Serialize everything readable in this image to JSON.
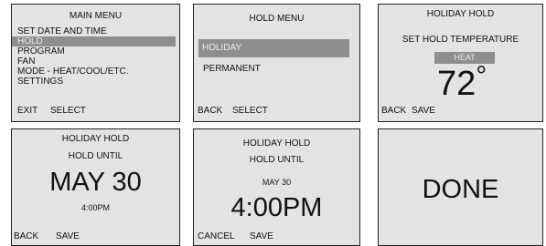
{
  "main_menu": {
    "title": "MAIN MENU",
    "items": [
      "SET DATE AND TIME",
      "HOLD",
      "PROGRAM",
      "FAN",
      "MODE - HEAT/COOL/ETC.",
      "SETTINGS"
    ],
    "selected_index": 1,
    "softkeys": {
      "left": "EXIT",
      "right": "SELECT"
    }
  },
  "hold_menu": {
    "title": "HOLD MENU",
    "items": [
      "HOLIDAY",
      "PERMANENT"
    ],
    "selected_index": 0,
    "softkeys": {
      "left": "BACK",
      "right": "SELECT"
    }
  },
  "holiday_hold_temp": {
    "title": "HOLIDAY HOLD",
    "subtitle": "SET HOLD TEMPERATURE",
    "mode": "HEAT",
    "temperature": "72",
    "degree": "°",
    "softkeys": {
      "left": "BACK",
      "right": "SAVE"
    }
  },
  "holiday_hold_date": {
    "title": "HOLIDAY HOLD",
    "subtitle": "HOLD UNTIL",
    "date": "MAY 30",
    "time": "4:00PM",
    "softkeys": {
      "left": "BACK",
      "right": "SAVE"
    }
  },
  "holiday_hold_time": {
    "title": "HOLIDAY HOLD",
    "subtitle": "HOLD UNTIL",
    "date": "MAY 30",
    "time": "4:00PM",
    "softkeys": {
      "left": "CANCEL",
      "right": "SAVE"
    }
  },
  "done_screen": {
    "message": "DONE"
  }
}
